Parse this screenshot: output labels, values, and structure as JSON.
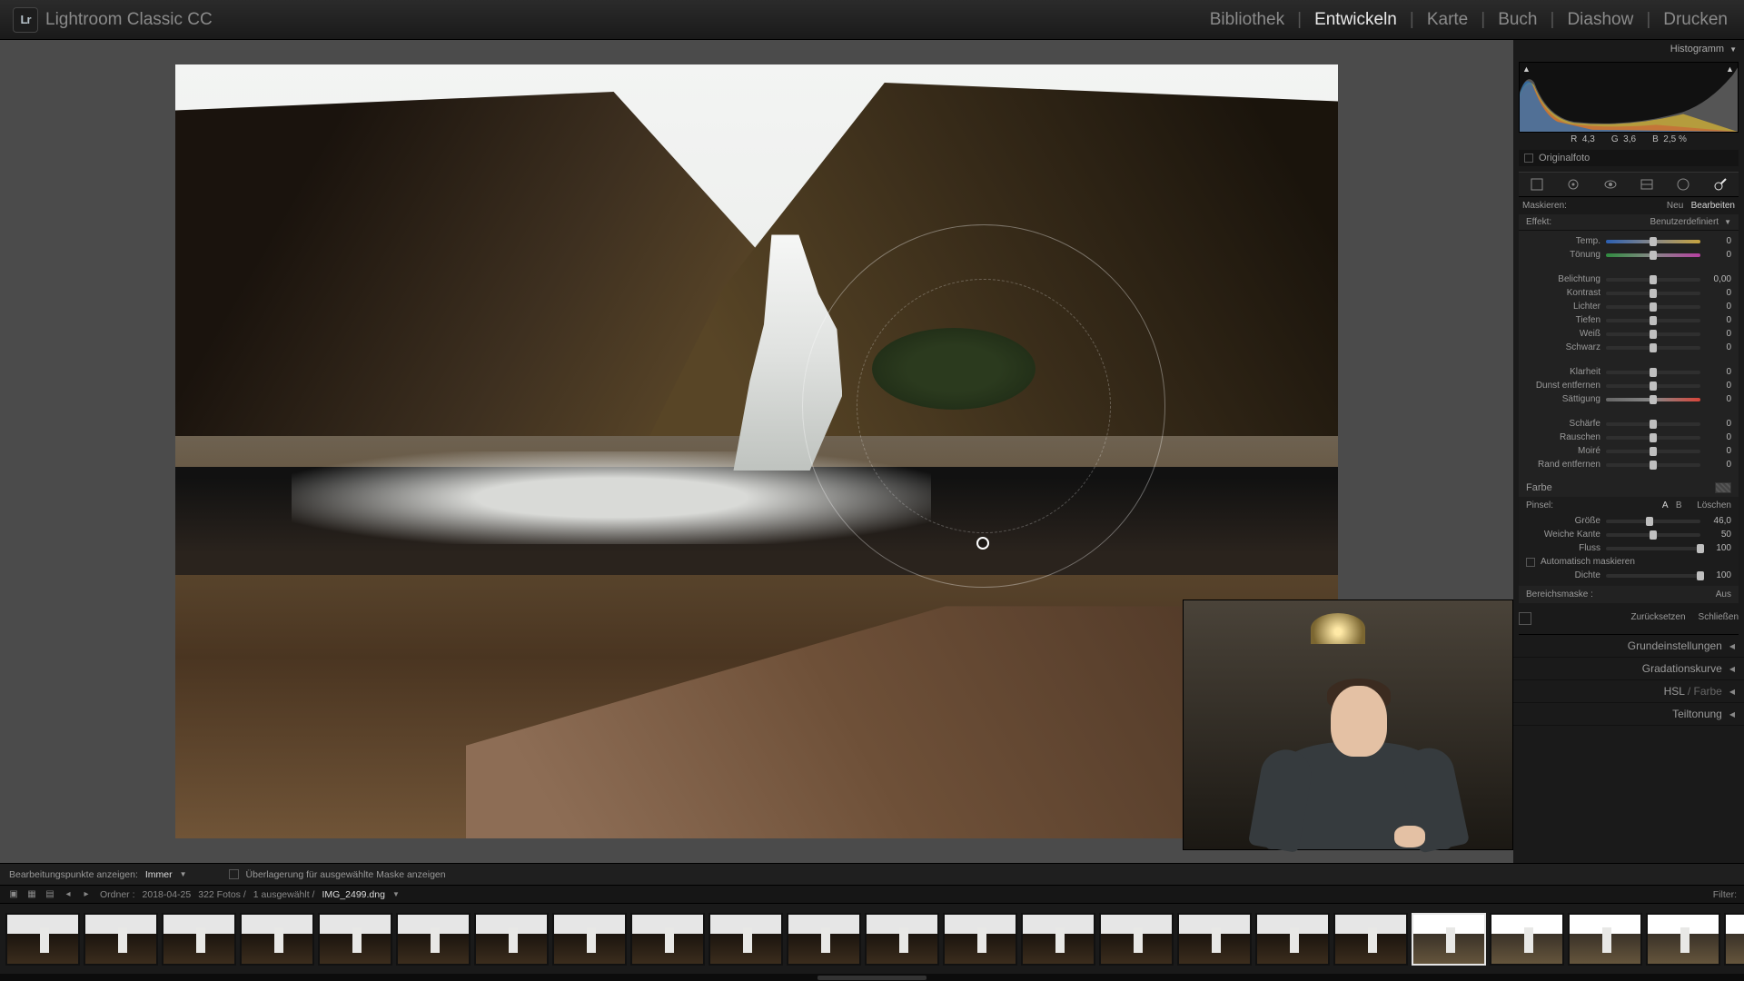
{
  "app": {
    "title": "Lightroom Classic CC",
    "logo": "Lr"
  },
  "nav": {
    "items": [
      "Bibliothek",
      "Entwickeln",
      "Karte",
      "Buch",
      "Diashow",
      "Drucken"
    ],
    "active": 1,
    "sep": "|"
  },
  "histogram": {
    "title": "Histogramm",
    "rgb": {
      "r_label": "R",
      "r": "4,3",
      "g_label": "G",
      "g": "3,6",
      "b_label": "B",
      "b": "2,5",
      "pct": "%"
    }
  },
  "original": {
    "label": "Originalfoto"
  },
  "tools": [
    "crop",
    "spot",
    "eye",
    "grad",
    "radial",
    "brush"
  ],
  "mask_header": {
    "label": "Maskieren:",
    "new": "Neu",
    "edit": "Bearbeiten"
  },
  "effect_row": {
    "label": "Effekt:",
    "value": "Benutzerdefiniert"
  },
  "sliders": [
    {
      "label": "Temp.",
      "type": "temp",
      "val": "0"
    },
    {
      "label": "Tönung",
      "type": "tint",
      "val": "0"
    }
  ],
  "sliders2": [
    {
      "label": "Belichtung",
      "val": "0,00"
    },
    {
      "label": "Kontrast",
      "val": "0"
    },
    {
      "label": "Lichter",
      "val": "0"
    },
    {
      "label": "Tiefen",
      "val": "0"
    },
    {
      "label": "Weiß",
      "val": "0"
    },
    {
      "label": "Schwarz",
      "val": "0"
    }
  ],
  "sliders3": [
    {
      "label": "Klarheit",
      "val": "0"
    },
    {
      "label": "Dunst entfernen",
      "val": "0"
    },
    {
      "label": "Sättigung",
      "type": "sat",
      "val": "0"
    }
  ],
  "sliders4": [
    {
      "label": "Schärfe",
      "val": "0"
    },
    {
      "label": "Rauschen",
      "val": "0"
    },
    {
      "label": "Moiré",
      "val": "0"
    },
    {
      "label": "Rand entfernen",
      "val": "0"
    }
  ],
  "color_row": {
    "label": "Farbe"
  },
  "brush": {
    "label": "Pinsel:",
    "a": "A",
    "b": "B",
    "erase": "Löschen",
    "size": {
      "label": "Größe",
      "val": "46,0",
      "pos": 46
    },
    "feather": {
      "label": "Weiche Kante",
      "val": "50",
      "pos": 50
    },
    "flow": {
      "label": "Fluss",
      "val": "100",
      "pos": 100
    },
    "auto": "Automatisch maskieren",
    "density": {
      "label": "Dichte",
      "val": "100",
      "pos": 100
    }
  },
  "range_mask": {
    "label": "Bereichsmaske :",
    "value": "Aus"
  },
  "actions": {
    "reset": "Zurücksetzen",
    "close": "Schließen"
  },
  "panels": [
    {
      "label": "Grundeinstellungen"
    },
    {
      "label": "Gradationskurve"
    },
    {
      "label": "HSL",
      "grey": " / Farbe"
    },
    {
      "label": "Teiltonung"
    }
  ],
  "below_bar": {
    "label": "Bearbeitungspunkte anzeigen:",
    "mode": "Immer",
    "overlay": "Überlagerung für ausgewählte Maske anzeigen"
  },
  "info_bar": {
    "folder_label": "Ordner :",
    "folder": "2018-04-25",
    "count": "322 Fotos /",
    "sel": "1 ausgewählt /",
    "fname": "IMG_2499.dng",
    "filter": "Filter:"
  },
  "filmstrip": {
    "count": 24,
    "sel": 18,
    "dots": "•••••"
  }
}
